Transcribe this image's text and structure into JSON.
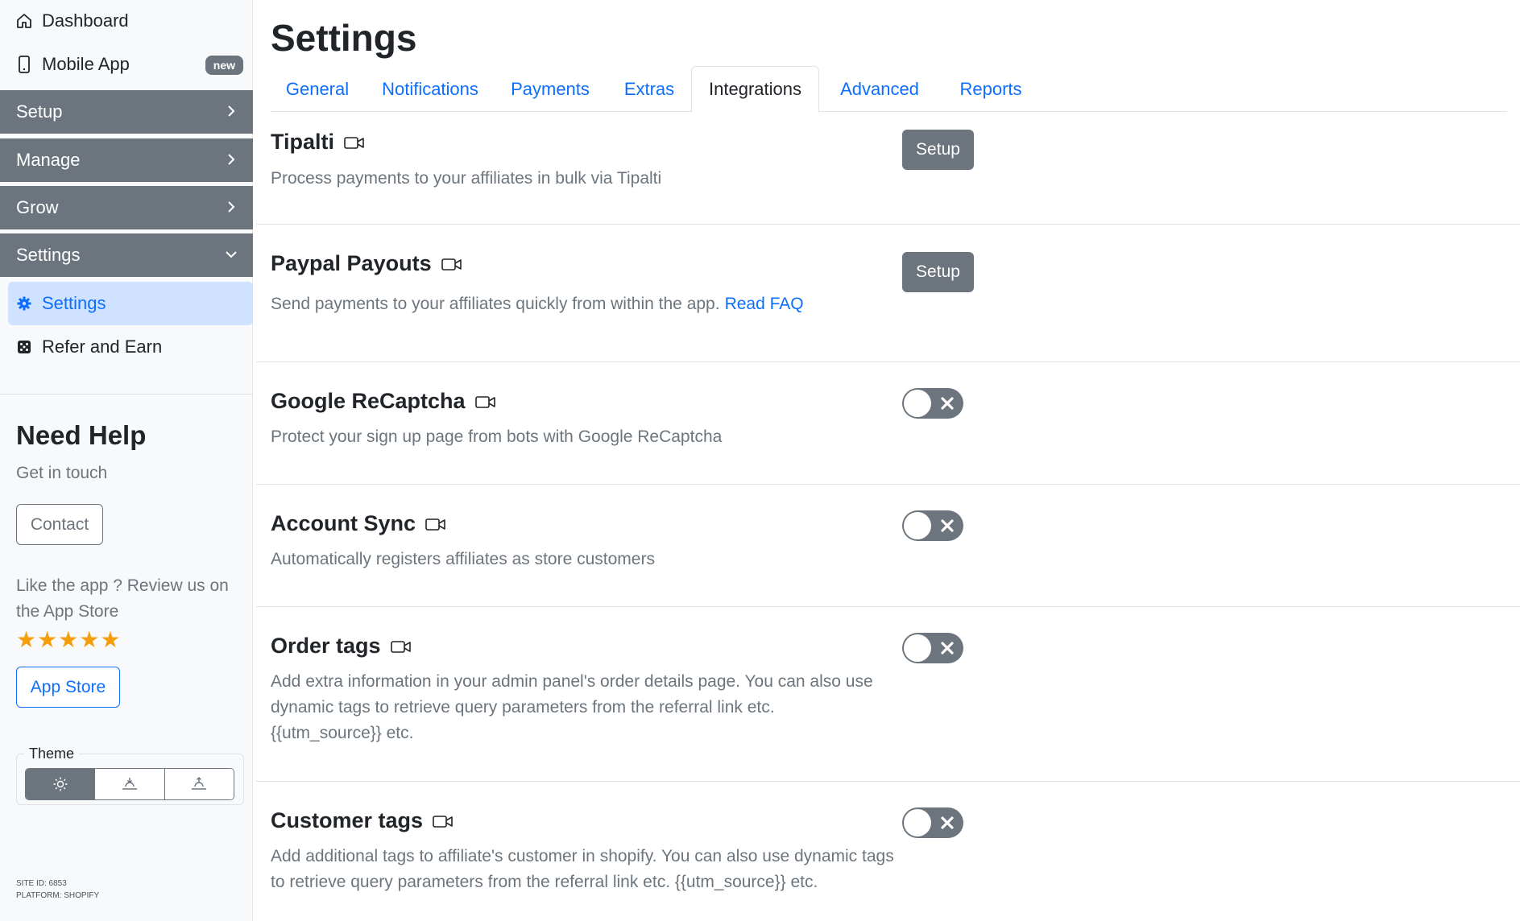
{
  "sidebar": {
    "dashboard": "Dashboard",
    "mobile_app": "Mobile App",
    "new_badge": "new",
    "sections": {
      "setup": "Setup",
      "manage": "Manage",
      "grow": "Grow",
      "settings": "Settings"
    },
    "sub_items": {
      "settings": "Settings",
      "refer": "Refer and Earn"
    },
    "help": {
      "title": "Need Help",
      "subtitle": "Get in touch",
      "contact": "Contact",
      "review_text": "Like the app ? Review us on the App Store",
      "stars": "★★★★★",
      "app_store": "App Store"
    },
    "theme": {
      "legend": "Theme",
      "options": [
        "light",
        "sunset",
        "sunrise"
      ],
      "selected": "light"
    },
    "site_id": "SITE ID: 6853",
    "platform": "PLATFORM: SHOPIFY"
  },
  "main": {
    "title": "Settings",
    "tabs": [
      {
        "label": "General"
      },
      {
        "label": "Notifications"
      },
      {
        "label": "Payments"
      },
      {
        "label": "Extras"
      },
      {
        "label": "Integrations",
        "active": true
      },
      {
        "label": "Advanced"
      },
      {
        "label": "Reports"
      }
    ],
    "integrations": [
      {
        "title": "Tipalti",
        "desc": "Process payments to your affiliates in bulk via Tipalti",
        "control": "button",
        "control_label": "Setup"
      },
      {
        "title": "Paypal Payouts",
        "desc": "Send payments to your affiliates quickly from within the app.",
        "link": "Read FAQ",
        "control": "button",
        "control_label": "Setup"
      },
      {
        "title": "Google ReCaptcha",
        "desc": "Protect your sign up page from bots with Google ReCaptcha",
        "control": "toggle",
        "enabled": false
      },
      {
        "title": "Account Sync",
        "desc": "Automatically registers affiliates as store customers",
        "control": "toggle",
        "enabled": false
      },
      {
        "title": "Order tags",
        "desc": "Add extra information in your admin panel's order details page. You can also use dynamic tags to retrieve query parameters from the referral link etc. {{utm_source}} etc.",
        "control": "toggle",
        "enabled": false
      },
      {
        "title": "Customer tags",
        "desc": "Add additional tags to affiliate's customer in shopify. You can also use dynamic tags to retrieve query parameters from the referral link etc. {{utm_source}} etc.",
        "control": "toggle",
        "enabled": false
      }
    ]
  },
  "colors": {
    "primary": "#0d6efd",
    "secondary": "#6c757d",
    "active_bg": "#cfe2ff",
    "star": "#f59e0b"
  }
}
